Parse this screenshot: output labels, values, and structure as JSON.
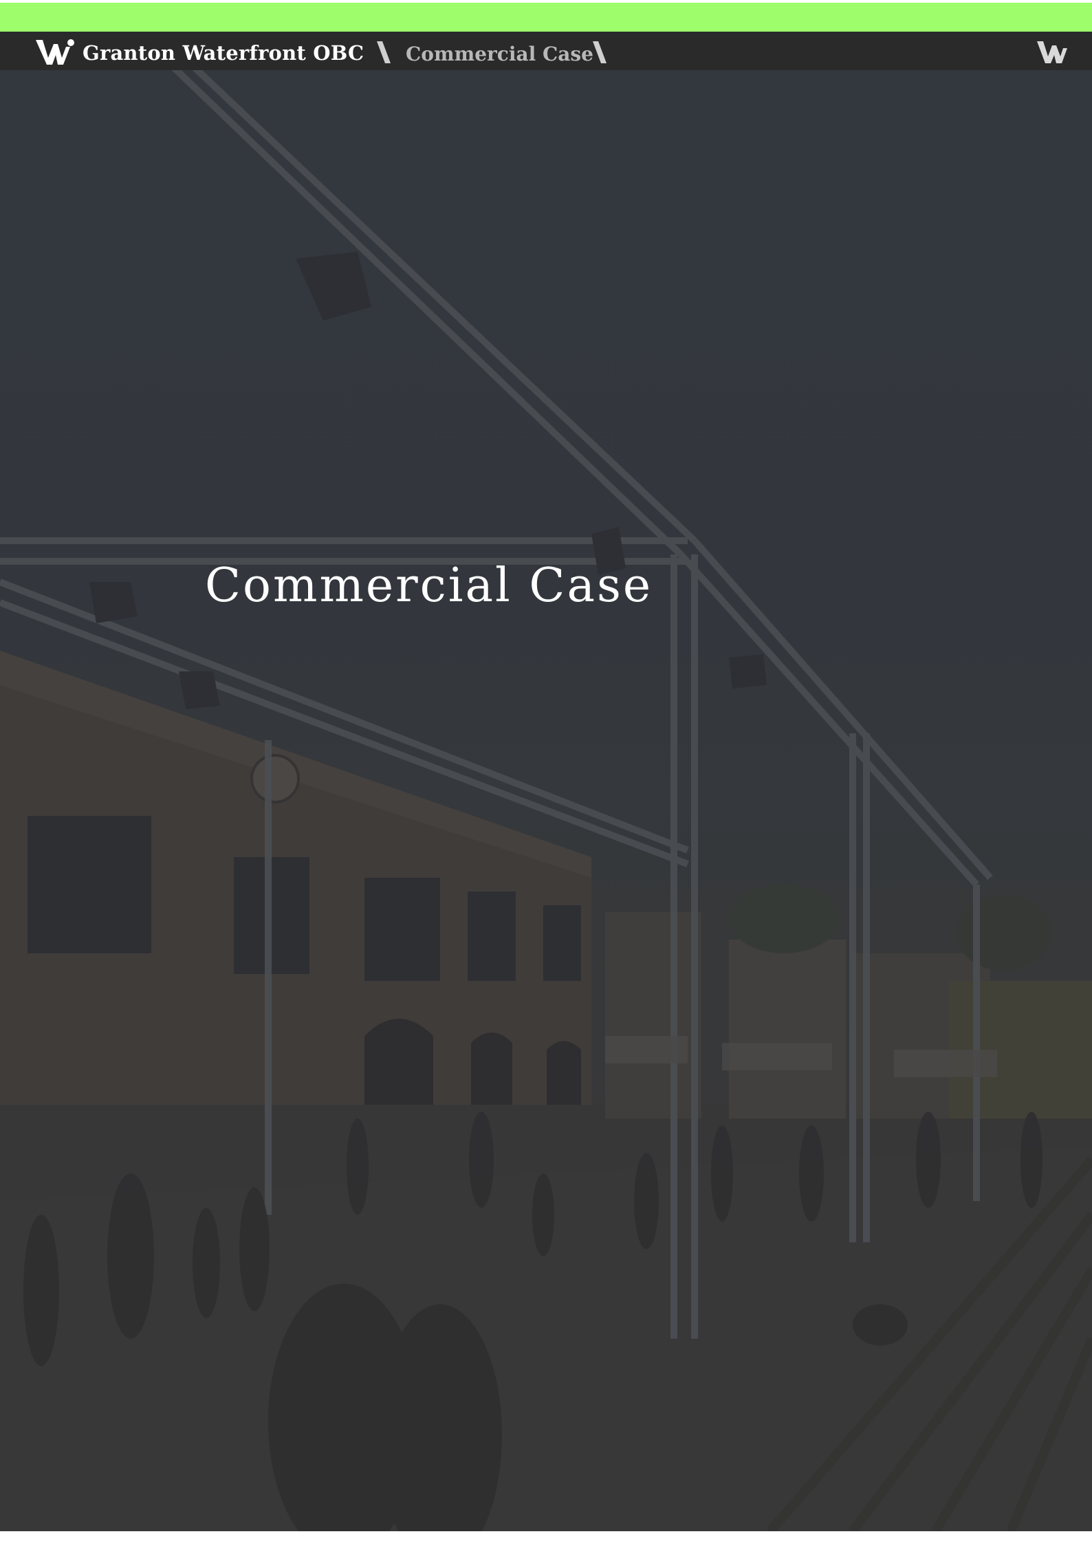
{
  "header": {
    "brand": "Granton Waterfront OBC",
    "section": "Commercial Case",
    "logo_icon": "w-monogram-icon",
    "corner_icon": "w-monogram-icon"
  },
  "cover": {
    "title": "Commercial Case",
    "background_image": "event-square-rendering"
  },
  "colors": {
    "accent": "#9dfd6b",
    "header_bg": "#2a2a2a",
    "overlay": "#363b42"
  }
}
